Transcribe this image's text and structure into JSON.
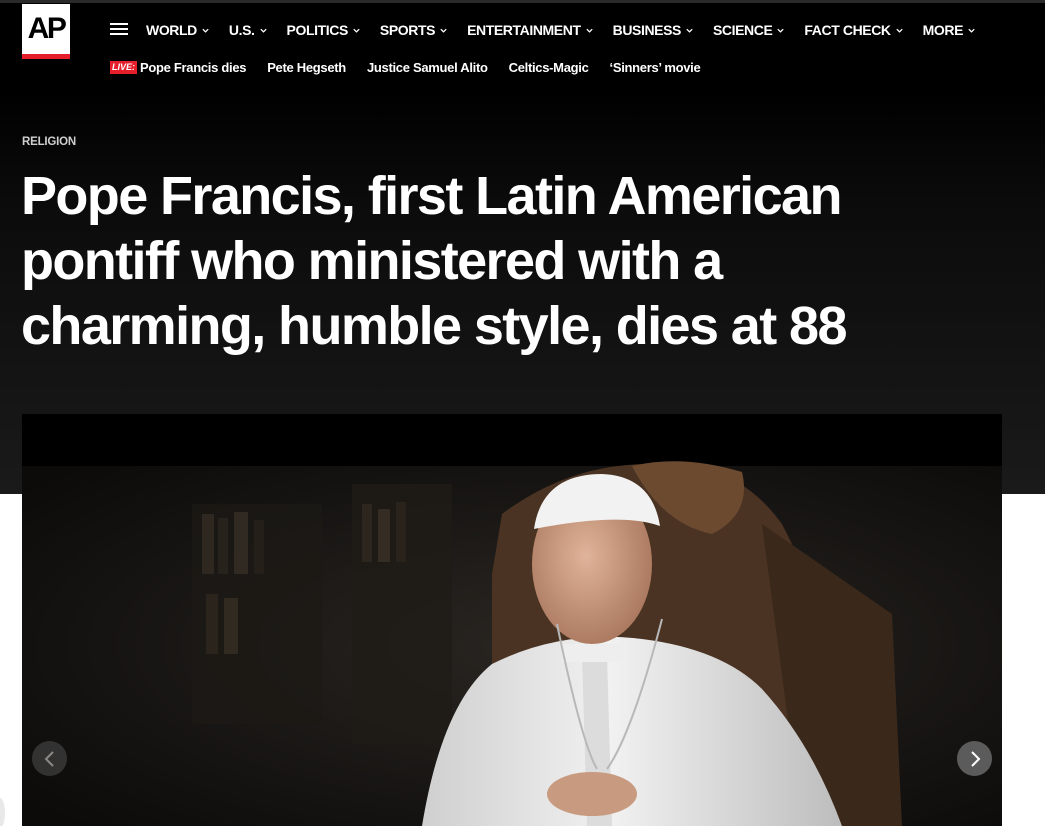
{
  "brand": {
    "logo_text": "AP",
    "accent_color": "#e61e2b"
  },
  "nav": {
    "menu_icon": "hamburger-icon",
    "items": [
      {
        "label": "WORLD"
      },
      {
        "label": "U.S."
      },
      {
        "label": "POLITICS"
      },
      {
        "label": "SPORTS"
      },
      {
        "label": "ENTERTAINMENT"
      },
      {
        "label": "BUSINESS"
      },
      {
        "label": "SCIENCE"
      },
      {
        "label": "FACT CHECK"
      },
      {
        "label": "MORE"
      }
    ]
  },
  "trending": {
    "live_badge": "LIVE:",
    "items": [
      {
        "label": "Pope Francis dies"
      },
      {
        "label": "Pete Hegseth"
      },
      {
        "label": "Justice Samuel Alito"
      },
      {
        "label": "Celtics-Magic"
      },
      {
        "label": "‘Sinners’ movie"
      }
    ]
  },
  "article": {
    "category": "RELIGION",
    "headline": "Pope Francis, first Latin American pontiff who ministered with a charming, humble style, dies at 88"
  },
  "carousel": {
    "prev_icon": "chevron-left-icon",
    "next_icon": "chevron-right-icon"
  }
}
